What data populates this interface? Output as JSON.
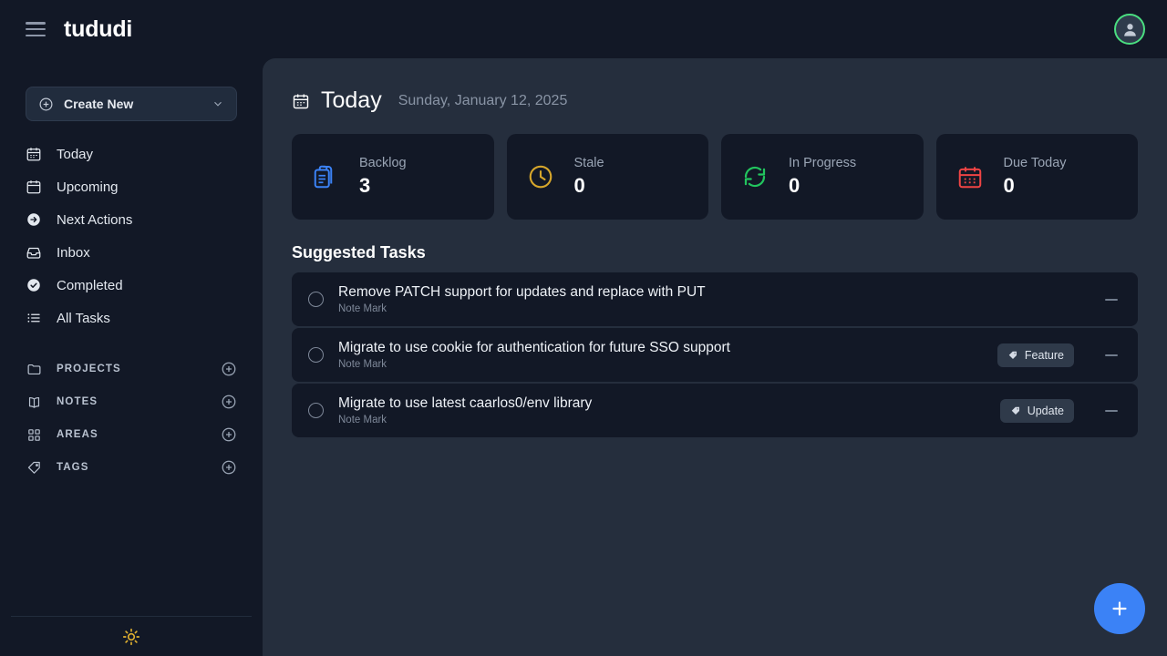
{
  "header": {
    "brand": "tududi",
    "menu_icon": "hamburger-icon",
    "avatar_icon": "user-avatar-icon"
  },
  "sidebar": {
    "create_button": {
      "label": "Create New",
      "leading_icon": "plus-circle-icon",
      "trailing_icon": "chevron-down-icon"
    },
    "nav_items": [
      {
        "label": "Today",
        "icon": "calendar-today-icon"
      },
      {
        "label": "Upcoming",
        "icon": "calendar-icon"
      },
      {
        "label": "Next Actions",
        "icon": "arrow-right-circle-icon"
      },
      {
        "label": "Inbox",
        "icon": "inbox-icon"
      },
      {
        "label": "Completed",
        "icon": "check-circle-icon"
      },
      {
        "label": "All Tasks",
        "icon": "list-icon"
      }
    ],
    "sections": [
      {
        "label": "PROJECTS",
        "icon": "folder-icon",
        "add_icon": "plus-circle-icon"
      },
      {
        "label": "NOTES",
        "icon": "book-open-icon",
        "add_icon": "plus-circle-icon"
      },
      {
        "label": "AREAS",
        "icon": "squares-grid-icon",
        "add_icon": "plus-circle-icon"
      },
      {
        "label": "TAGS",
        "icon": "tag-icon",
        "add_icon": "plus-circle-icon"
      }
    ],
    "theme_toggle_icon": "sun-icon"
  },
  "main": {
    "page_icon": "calendar-today-icon",
    "title": "Today",
    "date": "Sunday, January 12, 2025",
    "metrics": [
      {
        "label": "Backlog",
        "value": "3",
        "icon": "clipboard-list-icon",
        "color": "#3b82f6"
      },
      {
        "label": "Stale",
        "value": "0",
        "icon": "clock-icon",
        "color": "#d6a62b"
      },
      {
        "label": "In Progress",
        "value": "0",
        "icon": "refresh-icon",
        "color": "#22c55e"
      },
      {
        "label": "Due Today",
        "value": "0",
        "icon": "calendar-due-icon",
        "color": "#ef4444"
      }
    ],
    "suggested_title": "Suggested Tasks",
    "tasks": [
      {
        "title": "Remove PATCH support for updates and replace with PUT",
        "subtitle": "Note Mark",
        "tag": null,
        "checkbox_icon": "circle-checkbox-icon",
        "action_icon": "minus-icon"
      },
      {
        "title": "Migrate to use cookie for authentication for future SSO support",
        "subtitle": "Note Mark",
        "tag": "Feature",
        "tag_icon": "tag-icon",
        "checkbox_icon": "circle-checkbox-icon",
        "action_icon": "minus-icon"
      },
      {
        "title": "Migrate to use latest caarlos0/env library",
        "subtitle": "Note Mark",
        "tag": "Update",
        "tag_icon": "tag-icon",
        "checkbox_icon": "circle-checkbox-icon",
        "action_icon": "minus-icon"
      }
    ]
  },
  "fab": {
    "icon": "plus-icon"
  }
}
